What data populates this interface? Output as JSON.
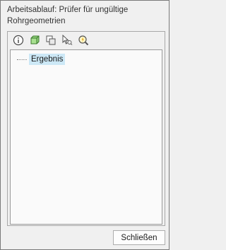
{
  "window": {
    "title": "Arbeitsablauf: Prüfer für ungültige Rohrgeometrien"
  },
  "toolbar": {
    "buttons": [
      {
        "name": "info-icon"
      },
      {
        "name": "green-box-icon"
      },
      {
        "name": "copy-boxes-icon"
      },
      {
        "name": "select-feature-icon"
      },
      {
        "name": "zoom-to-icon"
      }
    ]
  },
  "tree": {
    "items": [
      {
        "label": "Ergebnis",
        "selected": true
      }
    ]
  },
  "footer": {
    "close_label": "Schließen"
  }
}
